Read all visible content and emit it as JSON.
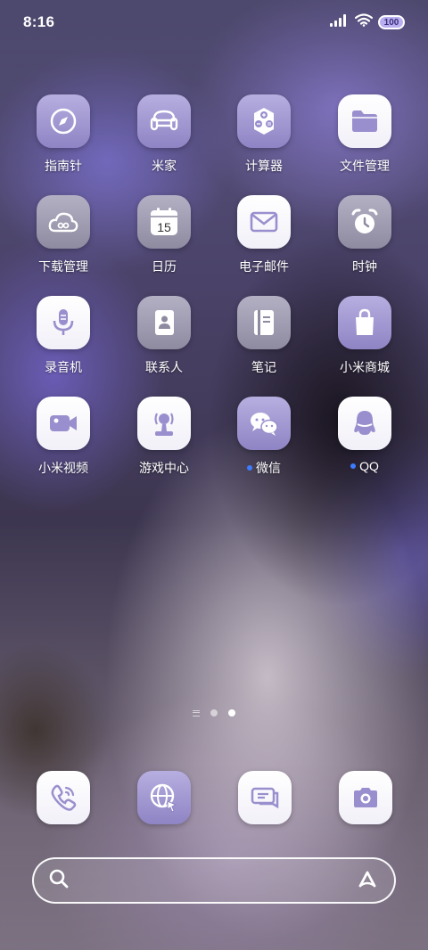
{
  "status_bar": {
    "time": "8:16",
    "battery": "100"
  },
  "apps": [
    {
      "label": "指南针",
      "icon": "compass-icon"
    },
    {
      "label": "米家",
      "icon": "sofa-icon"
    },
    {
      "label": "计算器",
      "icon": "calculator-icon"
    },
    {
      "label": "文件管理",
      "icon": "folder-icon"
    },
    {
      "label": "下载管理",
      "icon": "cloud-download-icon"
    },
    {
      "label": "日历",
      "icon": "calendar-icon",
      "date": "15"
    },
    {
      "label": "电子邮件",
      "icon": "mail-icon"
    },
    {
      "label": "时钟",
      "icon": "alarm-clock-icon"
    },
    {
      "label": "录音机",
      "icon": "microphone-icon"
    },
    {
      "label": "联系人",
      "icon": "contacts-icon"
    },
    {
      "label": "笔记",
      "icon": "notes-icon"
    },
    {
      "label": "小米商城",
      "icon": "shopping-bag-icon"
    },
    {
      "label": "小米视频",
      "icon": "video-camera-icon"
    },
    {
      "label": "游戏中心",
      "icon": "game-center-icon"
    },
    {
      "label": "微信",
      "icon": "wechat-icon"
    },
    {
      "label": "QQ",
      "icon": "qq-penguin-icon"
    }
  ],
  "dock": [
    {
      "icon": "phone-icon"
    },
    {
      "icon": "browser-globe-icon"
    },
    {
      "icon": "messages-icon"
    },
    {
      "icon": "camera-icon"
    }
  ],
  "pager": {
    "pages": 2,
    "active": 2
  },
  "colors": {
    "icon_accent": "#8f84c4",
    "notification_dot": "#3d7cff"
  }
}
